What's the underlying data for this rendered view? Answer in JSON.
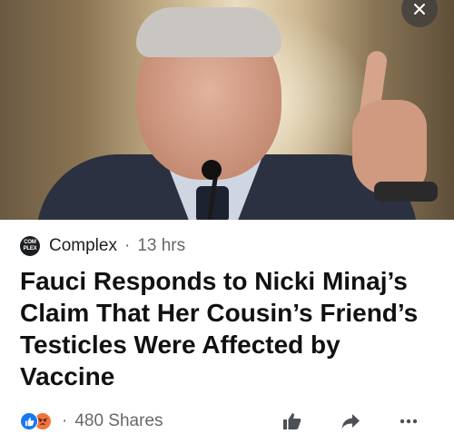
{
  "post": {
    "image": {
      "icon": "news-photo"
    },
    "close_icon": "close-icon",
    "source": {
      "logo_text": "COMPLEX",
      "name": "Complex",
      "separator": "·",
      "time": "13 hrs"
    },
    "headline": "Fauci Responds to Nicki Minaj’s Claim That Her Cousin’s Friend’s Testicles Were Affected by Vaccine",
    "reactions": {
      "icons": [
        "like-reaction-icon",
        "angry-reaction-icon"
      ],
      "separator": "·",
      "shares": "480 Shares"
    },
    "actions": {
      "icons": [
        "thumbs-up-icon",
        "share-arrow-icon",
        "more-dots-icon"
      ]
    }
  },
  "colors": {
    "like_blue": "#1877f2",
    "angry_orange": "#f2743a",
    "meta_gray": "#65676b",
    "text": "#1c1e21"
  }
}
